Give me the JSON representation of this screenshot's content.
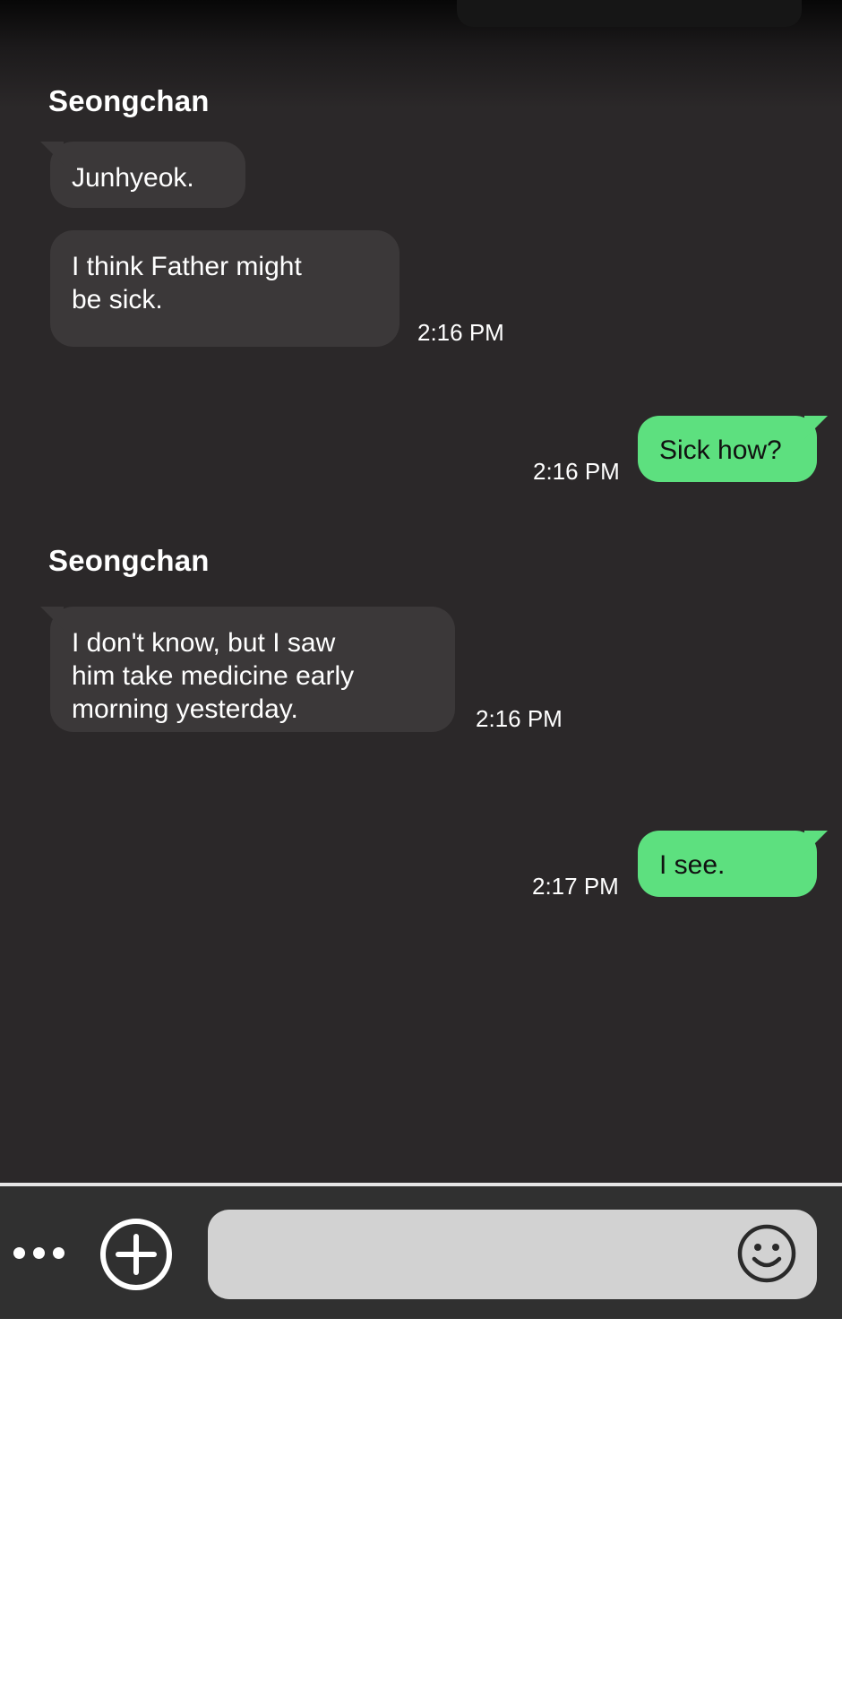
{
  "chat": {
    "messages": [
      {
        "sender": "Seongchan",
        "text": "Junhyeok.",
        "time": ""
      },
      {
        "text": "I think Father might\nbe sick.",
        "time": "2:16 PM"
      },
      {
        "text": "Sick how?",
        "time": "2:16 PM",
        "outgoing": true
      },
      {
        "sender": "Seongchan",
        "text": "I don't know, but I saw\nhim take medicine early\nmorning yesterday.",
        "time": "2:16 PM"
      },
      {
        "text": "I see.",
        "time": "2:17 PM",
        "outgoing": true
      }
    ]
  },
  "input_bar": {
    "more_icon": "more-horizontal-icon",
    "add_icon": "plus-circle-icon",
    "emoji_icon": "smiley-icon",
    "message_placeholder": ""
  },
  "colors": {
    "background": "#2b2829",
    "incoming_bubble": "#3b3839",
    "outgoing_bubble": "#5de07f",
    "input_field": "#d2d2d2"
  }
}
